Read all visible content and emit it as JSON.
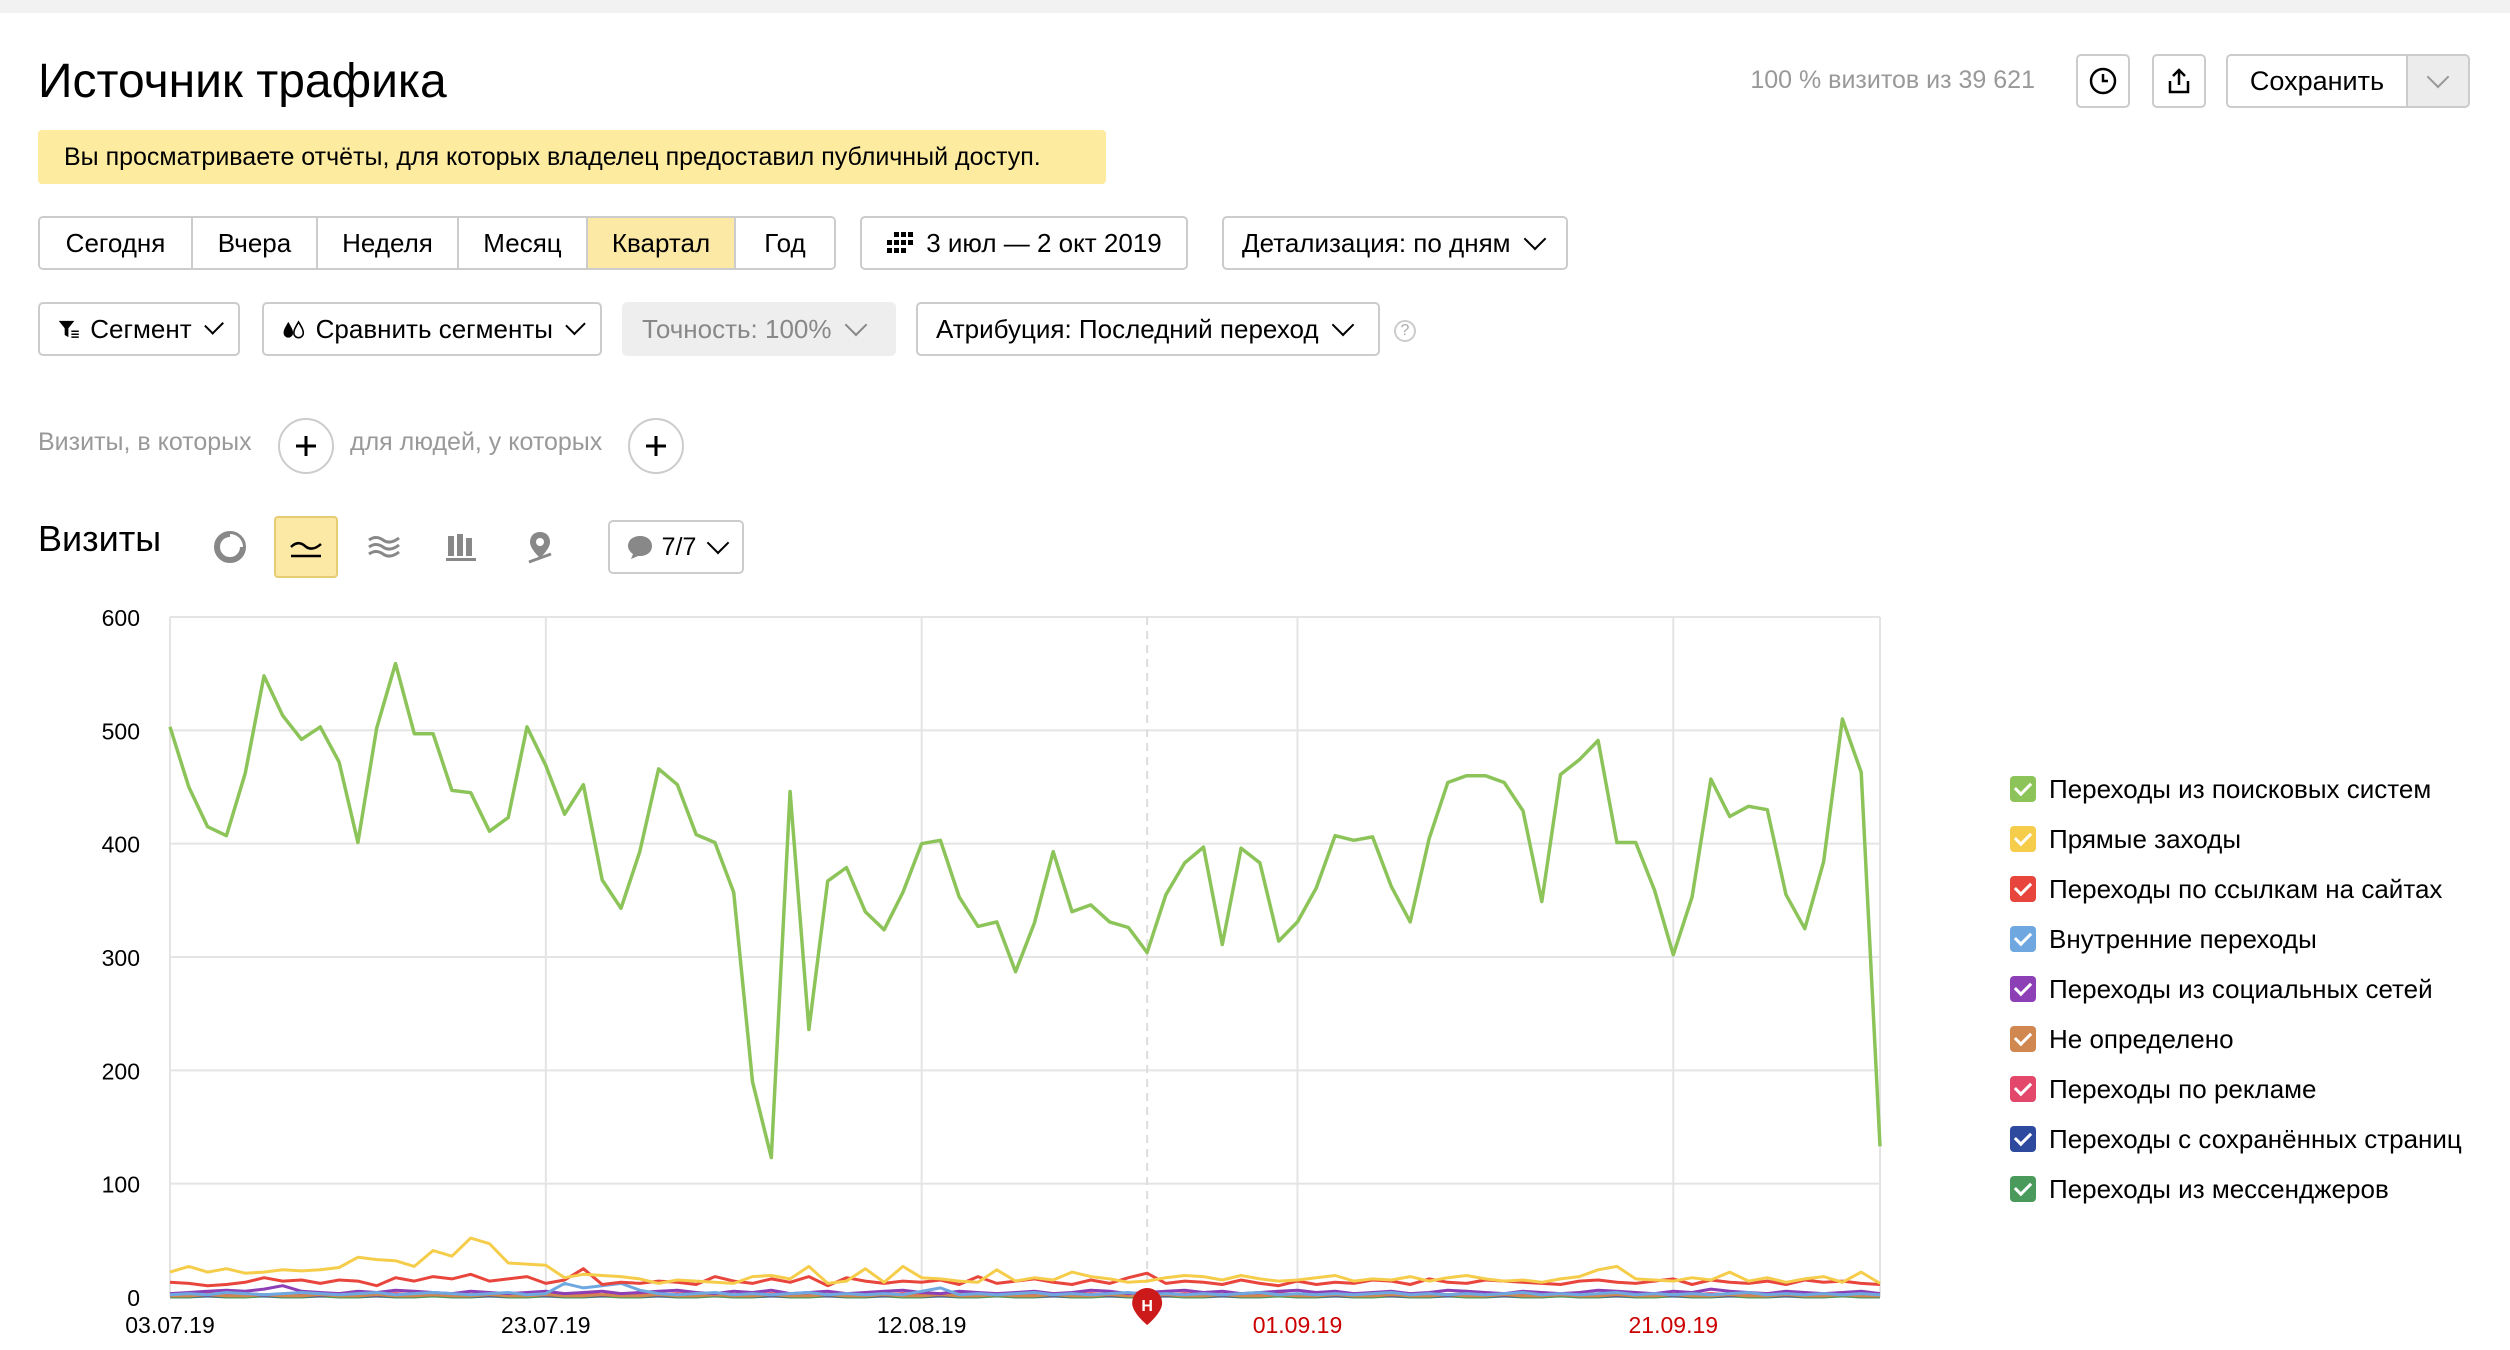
{
  "header": {
    "title": "Источник трафика",
    "notice": "Вы просматриваете отчёты, для которых владелец предоставил публичный доступ.",
    "visits_info": "100 % визитов из 39 621",
    "save_label": "Сохранить"
  },
  "filters": {
    "periods": [
      "Сегодня",
      "Вчера",
      "Неделя",
      "Месяц",
      "Квартал",
      "Год"
    ],
    "active_period": "Квартал",
    "date_range": "3 июл — 2 окт 2019",
    "detail": "Детализация: по дням",
    "segment": "Сегмент",
    "compare": "Сравнить сегменты",
    "accuracy": "Точность: 100%",
    "attribution": "Атрибуция: Последний переход",
    "help": "?"
  },
  "segment_builder": {
    "visits_label": "Визиты, в которых",
    "people_label": "для людей, у которых"
  },
  "report": {
    "title": "Визиты",
    "notes_count": "7/7",
    "view_icons": [
      "pie-chart-icon",
      "line-chart-icon",
      "area-chart-icon",
      "bar-chart-icon",
      "map-icon"
    ],
    "active_view": "line-chart-icon",
    "note_marker": "Н"
  },
  "colors": {
    "accent_yellow": "#fde9a6",
    "weekend_tick": "#cc0000",
    "note_marker": "#cc1a1a"
  },
  "chart_data": {
    "type": "line",
    "x_labels": [
      "03.07.19",
      "23.07.19",
      "12.08.19",
      "01.09.19",
      "21.09.19"
    ],
    "x_labels_weekend": [
      false,
      false,
      false,
      true,
      true
    ],
    "ylim": [
      0,
      600
    ],
    "y_ticks": [
      0,
      100,
      200,
      300,
      400,
      500,
      600
    ],
    "grid": true,
    "legend_position": "right",
    "series": [
      {
        "name": "Переходы из поисковых систем",
        "color": "#8cc45a",
        "values": [
          503,
          450,
          415,
          407,
          462,
          548,
          513,
          492,
          503,
          472,
          401,
          502,
          559,
          497,
          497,
          447,
          445,
          411,
          423,
          503,
          469,
          426,
          452,
          368,
          343,
          393,
          466,
          452,
          408,
          401,
          357,
          190,
          123,
          446,
          236,
          367,
          379,
          340,
          324,
          357,
          400,
          403,
          353,
          327,
          331,
          287,
          330,
          393,
          340,
          346,
          331,
          326,
          304,
          355,
          383,
          397,
          311,
          396,
          383,
          314,
          331,
          361,
          407,
          403,
          406,
          362,
          331,
          404,
          454,
          460,
          460,
          454,
          429,
          349,
          461,
          474,
          491,
          401,
          401,
          359,
          302,
          353,
          457,
          424,
          433,
          430,
          355,
          325,
          384,
          510,
          463,
          133
        ]
      },
      {
        "name": "Прямые заходы",
        "color": "#f5cd4b",
        "values": [
          22,
          27,
          22,
          25,
          21,
          22,
          24,
          23,
          24,
          26,
          35,
          33,
          32,
          27,
          41,
          36,
          52,
          47,
          30,
          29,
          28,
          17,
          20,
          19,
          18,
          16,
          12,
          15,
          14,
          13,
          12,
          18,
          19,
          16,
          27,
          12,
          14,
          25,
          13,
          27,
          17,
          16,
          14,
          13,
          24,
          14,
          17,
          15,
          22,
          18,
          16,
          13,
          14,
          17,
          19,
          18,
          15,
          19,
          16,
          14,
          15,
          17,
          19,
          14,
          16,
          15,
          18,
          14,
          17,
          19,
          16,
          14,
          15,
          13,
          16,
          18,
          24,
          27,
          16,
          15,
          14,
          17,
          15,
          22,
          14,
          17,
          13,
          16,
          18,
          13,
          22,
          12
        ]
      },
      {
        "name": "Переходы по ссылкам на сайтах",
        "color": "#e8453c",
        "values": [
          13,
          12,
          10,
          11,
          13,
          17,
          14,
          15,
          12,
          15,
          14,
          10,
          17,
          14,
          18,
          16,
          20,
          14,
          16,
          18,
          12,
          15,
          25,
          11,
          13,
          12,
          14,
          13,
          11,
          18,
          14,
          12,
          16,
          13,
          18,
          10,
          17,
          14,
          12,
          14,
          13,
          15,
          11,
          18,
          12,
          14,
          16,
          13,
          11,
          15,
          12,
          17,
          21,
          12,
          14,
          13,
          11,
          15,
          12,
          10,
          14,
          11,
          13,
          12,
          15,
          14,
          11,
          16,
          13,
          12,
          15,
          14,
          13,
          12,
          11,
          14,
          15,
          13,
          12,
          14,
          16,
          11,
          15,
          13,
          12,
          14,
          11,
          15,
          13,
          14,
          12,
          11
        ]
      },
      {
        "name": "Внутренние переходы",
        "color": "#6fa8e0",
        "values": [
          2,
          3,
          2,
          4,
          3,
          2,
          3,
          4,
          3,
          2,
          3,
          4,
          2,
          3,
          4,
          3,
          2,
          3,
          4,
          2,
          3,
          12,
          8,
          10,
          12,
          6,
          3,
          2,
          3,
          4,
          2,
          3,
          2,
          3,
          4,
          2,
          3,
          2,
          3,
          2,
          5,
          8,
          2,
          3,
          2,
          3,
          4,
          2,
          3,
          2,
          3,
          4,
          2,
          3,
          2,
          3,
          2,
          3,
          4,
          2,
          3,
          2,
          3,
          2,
          3,
          4,
          2,
          3,
          2,
          3,
          2,
          3,
          4,
          2,
          3,
          2,
          3,
          4,
          2,
          3,
          2,
          3,
          2,
          3,
          4,
          2,
          3,
          2,
          3,
          2,
          3,
          2
        ]
      },
      {
        "name": "Переходы из социальных сетей",
        "color": "#8d3fb5",
        "values": [
          3,
          4,
          5,
          6,
          5,
          7,
          10,
          5,
          4,
          3,
          5,
          4,
          6,
          5,
          4,
          3,
          5,
          4,
          3,
          4,
          5,
          3,
          4,
          5,
          3,
          4,
          5,
          6,
          4,
          3,
          5,
          4,
          6,
          3,
          4,
          5,
          3,
          4,
          5,
          6,
          4,
          3,
          5,
          4,
          3,
          4,
          5,
          3,
          4,
          6,
          5,
          3,
          4,
          5,
          6,
          4,
          5,
          3,
          4,
          5,
          6,
          4,
          5,
          3,
          4,
          5,
          3,
          4,
          6,
          5,
          4,
          3,
          5,
          4,
          3,
          4,
          6,
          5,
          4,
          3,
          5,
          4,
          7,
          5,
          4,
          3,
          5,
          4,
          3,
          4,
          5,
          3
        ]
      },
      {
        "name": "Не определено",
        "color": "#d08850",
        "values": [
          1,
          1,
          2,
          1,
          1,
          2,
          1,
          1,
          2,
          1,
          1,
          2,
          1,
          1,
          2,
          1,
          1,
          2,
          1,
          1,
          2,
          1,
          1,
          2,
          1,
          1,
          2,
          1,
          1,
          2,
          1,
          1,
          2,
          1,
          1,
          2,
          1,
          1,
          2,
          1,
          1,
          2,
          1,
          1,
          2,
          1,
          1,
          2,
          1,
          1,
          2,
          1,
          1,
          2,
          1,
          1,
          2,
          1,
          1,
          2,
          1,
          1,
          2,
          1,
          1,
          2,
          1,
          1,
          2,
          1,
          1,
          2,
          1,
          1,
          2,
          1,
          1,
          2,
          1,
          1,
          2,
          1,
          1,
          2,
          1,
          1,
          2,
          1,
          1,
          2,
          1,
          1
        ]
      },
      {
        "name": "Переходы по рекламе",
        "color": "#e3476b",
        "values": [
          2,
          2,
          3,
          2,
          3,
          2,
          2,
          3,
          2,
          3,
          2,
          2,
          3,
          2,
          3,
          2,
          2,
          3,
          2,
          3,
          2,
          2,
          3,
          2,
          3,
          2,
          2,
          3,
          2,
          3,
          2,
          2,
          3,
          2,
          3,
          2,
          2,
          3,
          2,
          3,
          2,
          2,
          3,
          2,
          3,
          2,
          2,
          3,
          2,
          3,
          2,
          2,
          3,
          2,
          3,
          2,
          2,
          3,
          2,
          3,
          2,
          2,
          3,
          2,
          3,
          2,
          2,
          3,
          2,
          3,
          2,
          2,
          3,
          2,
          3,
          2,
          2,
          3,
          2,
          3,
          2,
          2,
          3,
          2,
          3,
          2,
          2,
          3,
          2,
          3,
          2,
          2
        ]
      },
      {
        "name": "Переходы с сохранённых страниц",
        "color": "#2e4a9e",
        "values": [
          1,
          1,
          1,
          1,
          2,
          1,
          1,
          1,
          1,
          2,
          1,
          1,
          1,
          1,
          2,
          1,
          1,
          1,
          1,
          2,
          1,
          1,
          1,
          1,
          2,
          1,
          1,
          1,
          1,
          2,
          1,
          1,
          1,
          1,
          2,
          1,
          1,
          1,
          1,
          2,
          1,
          1,
          1,
          1,
          2,
          1,
          1,
          1,
          1,
          2,
          1,
          1,
          1,
          1,
          2,
          1,
          1,
          1,
          1,
          2,
          1,
          1,
          1,
          1,
          2,
          1,
          1,
          1,
          1,
          2,
          1,
          1,
          1,
          1,
          2,
          1,
          1,
          1,
          1,
          2,
          1,
          1,
          1,
          1,
          2,
          1,
          1,
          1,
          1,
          2,
          1,
          1
        ]
      },
      {
        "name": "Переходы из мессенджеров",
        "color": "#4a9a5c",
        "values": [
          0,
          0,
          1,
          0,
          0,
          1,
          0,
          0,
          1,
          0,
          0,
          1,
          0,
          0,
          1,
          0,
          0,
          1,
          0,
          0,
          1,
          0,
          0,
          1,
          0,
          0,
          1,
          0,
          0,
          1,
          0,
          0,
          1,
          0,
          0,
          1,
          0,
          0,
          1,
          0,
          0,
          1,
          0,
          0,
          1,
          0,
          0,
          1,
          0,
          0,
          1,
          0,
          0,
          1,
          0,
          0,
          1,
          0,
          0,
          1,
          0,
          0,
          1,
          0,
          0,
          1,
          0,
          0,
          1,
          0,
          0,
          1,
          0,
          0,
          1,
          0,
          0,
          1,
          0,
          0,
          1,
          0,
          0,
          1,
          0,
          0,
          1,
          0,
          0,
          1,
          0,
          0
        ]
      }
    ]
  }
}
